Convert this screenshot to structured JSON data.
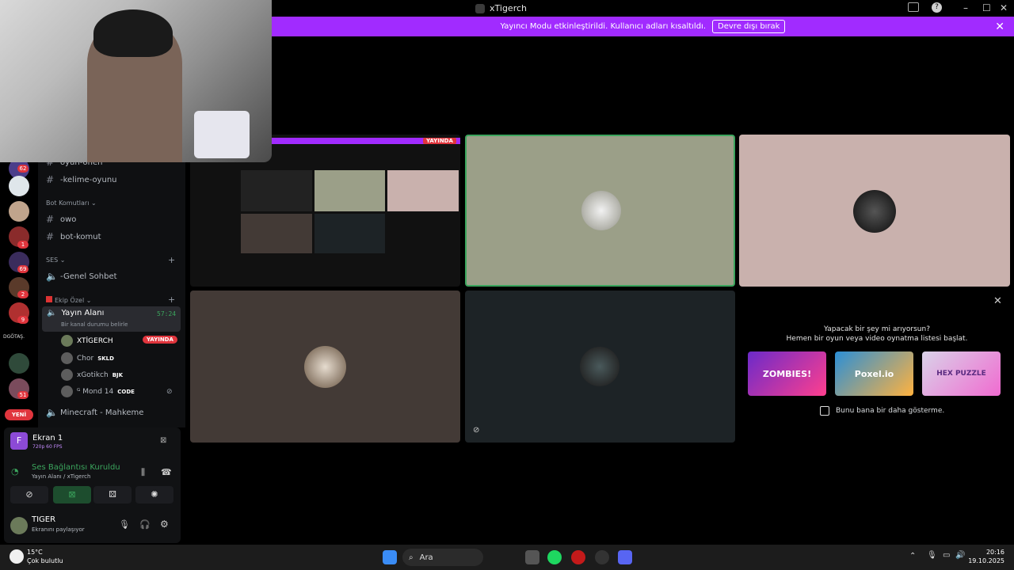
{
  "window": {
    "title": "xTigerch"
  },
  "banner": {
    "message": "Yayıncı Modu etkinleştirildi. Kullanıcı adları kısaltıldı.",
    "button": "Devre dışı bırak"
  },
  "servers": {
    "badges": [
      "62",
      "1",
      "69",
      "2",
      "9",
      "51"
    ],
    "label": "DGÖTAŞ.",
    "new_label": "YENİ"
  },
  "channels": {
    "top_partial": "oyun-önen",
    "items": [
      {
        "name": "-kelime-oyunu"
      },
      {
        "name": "owo"
      },
      {
        "name": "bot-komut"
      }
    ],
    "cat_bot": "Bot Komutları",
    "cat_ses": "SES",
    "voice_general": "-Genel Sohbet",
    "cat_team": "Ekip Özel",
    "active_voice": "Yayın Alanı",
    "active_timer": "57:24",
    "active_status": "Bir kanal durumu belirle",
    "users": [
      {
        "name": "XTİGERCH",
        "tag": "YAYINDA"
      },
      {
        "name": "Chor",
        "tag": "SKLD"
      },
      {
        "name": "xGotikch",
        "tag": "BJK"
      },
      {
        "name": "ᴳ Mond 14",
        "tag": "CODE"
      }
    ],
    "minecraft": "Minecraft - Mahkeme"
  },
  "panel": {
    "screen_title": "Ekran 1",
    "screen_sub": "720p 60 FPS",
    "voice_status": "Ses Bağlantısı Kuruldu",
    "voice_path": "Yayın Alanı  / xTigerch",
    "username": "TIGER",
    "user_status": "Ekranını paylaşıyor"
  },
  "stream": {
    "live_label": "YAYINDA",
    "prompt_line1": "Yapacak bir şey mi arıyorsun?",
    "prompt_line2": "Hemen bir oyun veya video oynatma listesi başlat.",
    "games": [
      "ZOMBIES!",
      "Poxel.io",
      "HEX PUZZLE"
    ],
    "dont_show": "Bunu bana bir daha gösterme."
  },
  "taskbar": {
    "temp": "15°C",
    "weather": "Çok bulutlu",
    "search": "Ara",
    "time": "20:16",
    "date": "19.10.2025"
  },
  "colors": {
    "accent": "#a12bff",
    "live": "#e0353d",
    "speaking": "#3ba55d"
  }
}
